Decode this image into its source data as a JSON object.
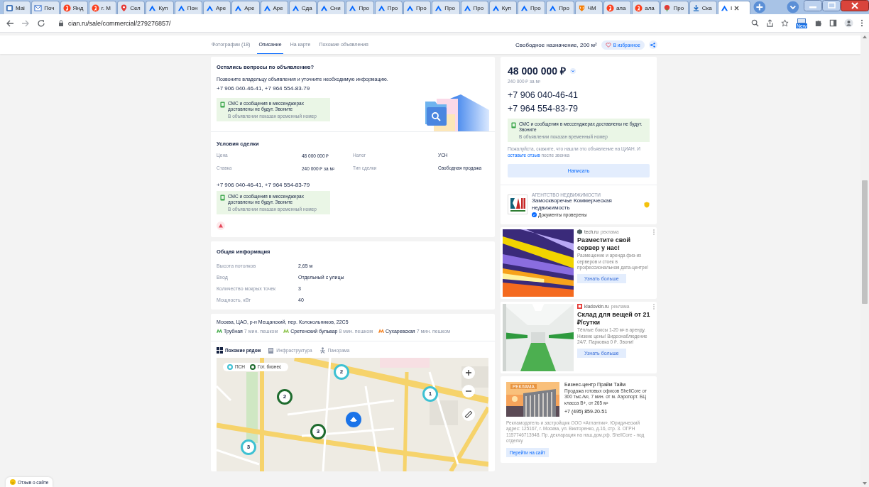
{
  "browser": {
    "tabs": [
      {
        "kind": "app",
        "label": "Mai",
        "selected": false
      },
      {
        "kind": "mail",
        "label": "Поч",
        "selected": false
      },
      {
        "kind": "yandex",
        "label": "Янд",
        "selected": false
      },
      {
        "kind": "yandex",
        "label": "г. М",
        "selected": false
      },
      {
        "kind": "pin",
        "label": "Сел",
        "selected": false
      },
      {
        "kind": "cian",
        "label": "Куп",
        "selected": false
      },
      {
        "kind": "cian",
        "label": "Пон",
        "selected": false
      },
      {
        "kind": "cian",
        "label": "Аре",
        "selected": false
      },
      {
        "kind": "cian",
        "label": "Аре",
        "selected": false
      },
      {
        "kind": "cian",
        "label": "Аре",
        "selected": false
      },
      {
        "kind": "cian",
        "label": "Сда",
        "selected": false
      },
      {
        "kind": "cian",
        "label": "Сни",
        "selected": false
      },
      {
        "kind": "cian",
        "label": "Про",
        "selected": false
      },
      {
        "kind": "cian",
        "label": "Про",
        "selected": false
      },
      {
        "kind": "cian",
        "label": "Про",
        "selected": false
      },
      {
        "kind": "cian",
        "label": "Про",
        "selected": false
      },
      {
        "kind": "cian",
        "label": "Про",
        "selected": false
      },
      {
        "kind": "cian",
        "label": "Куп",
        "selected": false
      },
      {
        "kind": "cian",
        "label": "Про",
        "selected": false
      },
      {
        "kind": "cian",
        "label": "Про",
        "selected": false
      },
      {
        "kind": "shield",
        "label": "ЧМ",
        "selected": false
      },
      {
        "kind": "yandex",
        "label": "ала",
        "selected": false
      },
      {
        "kind": "yandex",
        "label": "ала",
        "selected": false
      },
      {
        "kind": "flower",
        "label": "Про",
        "selected": false
      },
      {
        "kind": "download",
        "label": "Ска",
        "selected": false
      },
      {
        "kind": "cian",
        "label": "I",
        "selected": true
      }
    ],
    "url": "cian.ru/sale/commercial/279276857/",
    "extension_badge": "New"
  },
  "nav": {
    "tabs": [
      {
        "label": "Фотографии (18)",
        "selected": false
      },
      {
        "label": "Описание",
        "selected": true
      },
      {
        "label": "На карте",
        "selected": false
      },
      {
        "label": "Похожие объявления",
        "selected": false
      }
    ],
    "title": "Свободное назначение, 200 м²",
    "favorite_button": "В избранное"
  },
  "contact_card": {
    "heading": "Остались вопросы по объявлению?",
    "text": "Позвоните владельцу объявления и уточните необходимую информацию.",
    "phones": "+7 906 040-46-41, +7 964 554-83-79",
    "notice": {
      "title": "СМС и сообщения в мессенджерах доставлены не будут. Звоните",
      "subtitle": "В объявлении показан временный номер"
    }
  },
  "deal_card": {
    "heading": "Условия сделки",
    "rows": [
      {
        "label": "Цена",
        "value": "48 000 000 ₽"
      },
      {
        "label": "Налог",
        "value": "УСН"
      },
      {
        "label": "Ставка",
        "value": "240 000 ₽ за м²"
      },
      {
        "label": "Тип сделки",
        "value": "Свободная продажа"
      }
    ],
    "phones": "+7 906 040-46-41, +7 964 554-83-79",
    "notice": {
      "title": "СМС и сообщения в мессенджерах доставлены не будут. Звоните",
      "subtitle": "В объявлении показан временный номер"
    }
  },
  "info_card": {
    "heading": "Общая информация",
    "rows": [
      {
        "label": "Высота потолков",
        "value": "2,65 м"
      },
      {
        "label": "Вход",
        "value": "Отдельный с улицы"
      },
      {
        "label": "Количество мокрых точек",
        "value": "3"
      },
      {
        "label": "Мощность, кВт",
        "value": "40"
      }
    ]
  },
  "location_card": {
    "address": "Москва, ЦАО, р-н Мещанский, пер. Колокольников, 22С5",
    "metro": [
      {
        "station": "Трубная",
        "time": "7 мин. пешком",
        "color": "#4caf50"
      },
      {
        "station": "Сретенский бульвар",
        "time": "8 мин. пешком",
        "color": "#8bc34a"
      },
      {
        "station": "Сухаревская",
        "time": "7 мин. пешком",
        "color": "#f58220"
      }
    ],
    "map_tabs": [
      {
        "label": "Похожие рядом",
        "selected": true
      },
      {
        "label": "Инфраструктура",
        "selected": false
      },
      {
        "label": "Панорама",
        "selected": false
      }
    ],
    "legend": [
      {
        "label": "ПСН",
        "color": "#3ec1d3"
      },
      {
        "label": "Гот. бизнес",
        "color": "#1e6b2e"
      }
    ],
    "markers": [
      {
        "count": "2",
        "color": "#3ec1d3"
      },
      {
        "count": "2",
        "color": "#1e6b2e"
      },
      {
        "count": "1",
        "color": "#3ec1d3"
      },
      {
        "count": "3",
        "color": "#1e6b2e"
      },
      {
        "count": "3",
        "color": "#3ec1d3"
      }
    ]
  },
  "price_card": {
    "price": "48 000 000 ₽",
    "price_per_m2": "240 000 ₽ за м²",
    "phones": [
      "+7 906 040-46-41",
      "+7 964 554-83-79"
    ],
    "notice": {
      "title": "СМС и сообщения в мессенджерах доставлены не будут. Звоните",
      "subtitle": "В объявлении показан временный номер"
    },
    "feedback_text": "Пожалуйста, скажите, что нашли это объявление на ЦИАН. И",
    "feedback_link": "оставьте отзыв",
    "feedback_tail": "после звонка",
    "button": "Написать"
  },
  "agency": {
    "type": "АГЕНТСТВО НЕДВИЖИМОСТИ",
    "name": "Замоскворечье Коммерческая недвижимость",
    "verified": "Документы проверены"
  },
  "ads": [
    {
      "kind": "servers",
      "domain": "tech.ru",
      "label": "реклама",
      "title": "Разместите свой сервер у нас!",
      "text": "Размещение и аренда физ-их серверов и стоек в профессиональном дата-центре!",
      "button": "Узнать больше"
    },
    {
      "kind": "storage",
      "domain": "kladovkin.ru",
      "label": "реклама",
      "title": "Склад для вещей от 21 ₽/сутки",
      "text": "Тёплые боксы 1-20 м² в аренду. Низкие цены! Видеонаблюдение 24/7. Парковка 0 ₽. Звони!",
      "button": "Узнать больше"
    }
  ],
  "promo": {
    "badge": "РЕКЛАМА",
    "title": "Бизнес-центр Прайм Тайм",
    "text": "Продажа готовых офисов ShellCore от 300 тыс./м², 7 мин. от м. Аэропорт. БЦ класса B+, от 265 м²",
    "phone": "+7 (495) 859-20-51",
    "disclaimer": "Рекламодатель и застройщик ООО «Атлантик». Юридический адрес: 125167, г. Москва, ул. Викторенко, д.16, стр. 3. ОГРН 1157746713948. Пр. декларация на наш.дом.рф. ShellCore - под отделку",
    "button": "Перейти на сайт"
  },
  "feedback_button": "Отзыв о сайте"
}
